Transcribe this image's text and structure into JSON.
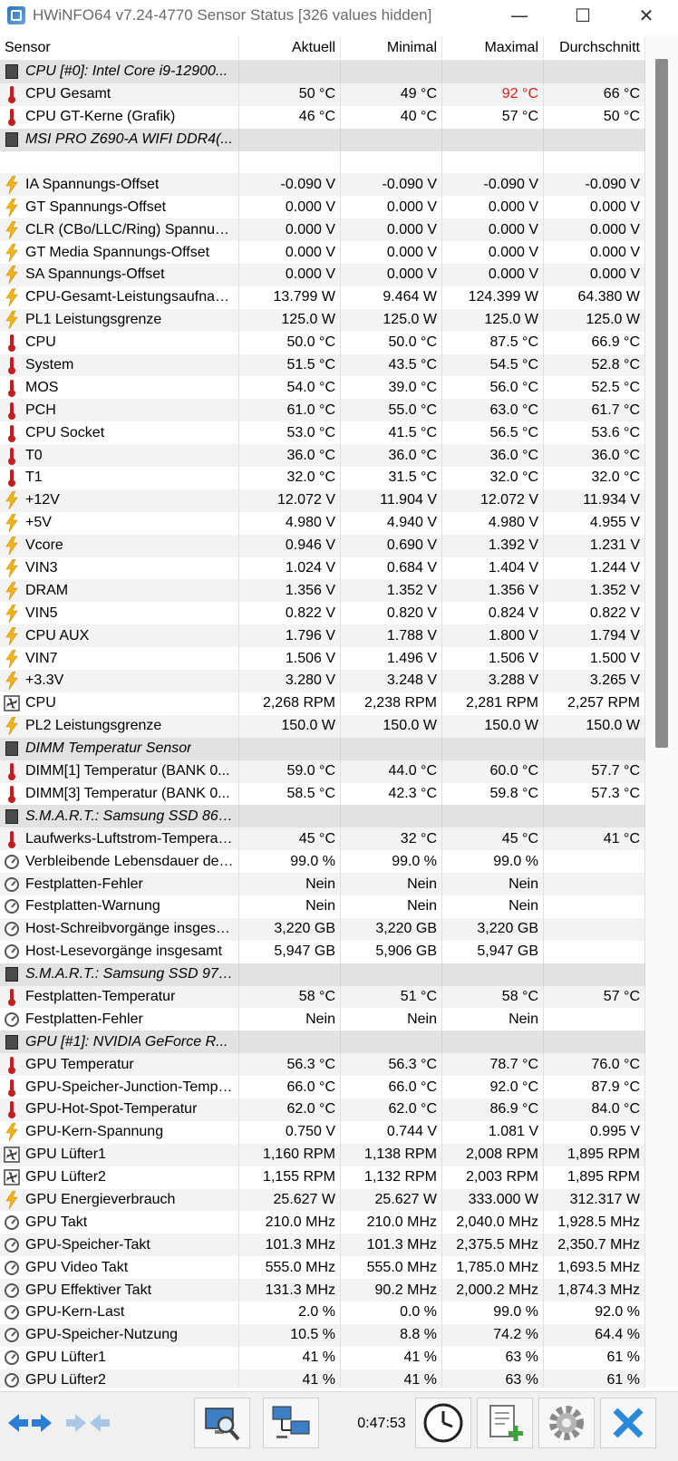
{
  "window": {
    "title": "HWiNFO64 v7.24-4770 Sensor Status [326 values hidden]",
    "minimize_glyph": "—",
    "maximize_glyph": "☐",
    "close_glyph": "✕"
  },
  "columns": [
    "Sensor",
    "Aktuell",
    "Minimal",
    "Maximal",
    "Durchschnitt"
  ],
  "rows": [
    {
      "type": "group",
      "icon": "chip-icon",
      "name": "CPU [#0]: Intel Core i9-12900...",
      "v": [
        "",
        "",
        "",
        ""
      ]
    },
    {
      "type": "data",
      "icon": "thermometer-icon",
      "name": "CPU Gesamt",
      "v": [
        "50 °C",
        "49 °C",
        "92 °C",
        "66 °C"
      ],
      "highlight_max": true
    },
    {
      "type": "data",
      "icon": "thermometer-icon",
      "name": "CPU GT-Kerne (Grafik)",
      "v": [
        "46 °C",
        "40 °C",
        "57 °C",
        "50 °C"
      ]
    },
    {
      "type": "group",
      "icon": "chip-icon",
      "name": "MSI PRO Z690-A WIFI DDR4(...",
      "v": [
        "",
        "",
        "",
        ""
      ]
    },
    {
      "type": "empty",
      "icon": "",
      "name": "",
      "v": [
        "",
        "",
        "",
        ""
      ]
    },
    {
      "type": "data",
      "icon": "lightning-icon",
      "name": "IA Spannungs-Offset",
      "v": [
        "-0.090 V",
        "-0.090 V",
        "-0.090 V",
        "-0.090 V"
      ]
    },
    {
      "type": "data",
      "icon": "lightning-icon",
      "name": "GT Spannungs-Offset",
      "v": [
        "0.000 V",
        "0.000 V",
        "0.000 V",
        "0.000 V"
      ]
    },
    {
      "type": "data",
      "icon": "lightning-icon",
      "name": "CLR (CBo/LLC/Ring) Spannung...",
      "v": [
        "0.000 V",
        "0.000 V",
        "0.000 V",
        "0.000 V"
      ]
    },
    {
      "type": "data",
      "icon": "lightning-icon",
      "name": "GT Media Spannungs-Offset",
      "v": [
        "0.000 V",
        "0.000 V",
        "0.000 V",
        "0.000 V"
      ]
    },
    {
      "type": "data",
      "icon": "lightning-icon",
      "name": "SA Spannungs-Offset",
      "v": [
        "0.000 V",
        "0.000 V",
        "0.000 V",
        "0.000 V"
      ]
    },
    {
      "type": "data",
      "icon": "lightning-icon",
      "name": "CPU-Gesamt-Leistungsaufnahme",
      "v": [
        "13.799 W",
        "9.464 W",
        "124.399 W",
        "64.380 W"
      ]
    },
    {
      "type": "data",
      "icon": "lightning-icon",
      "name": "PL1 Leistungsgrenze",
      "v": [
        "125.0 W",
        "125.0 W",
        "125.0 W",
        "125.0 W"
      ]
    },
    {
      "type": "data",
      "icon": "thermometer-icon",
      "name": "CPU",
      "v": [
        "50.0 °C",
        "50.0 °C",
        "87.5 °C",
        "66.9 °C"
      ]
    },
    {
      "type": "data",
      "icon": "thermometer-icon",
      "name": "System",
      "v": [
        "51.5 °C",
        "43.5 °C",
        "54.5 °C",
        "52.8 °C"
      ]
    },
    {
      "type": "data",
      "icon": "thermometer-icon",
      "name": "MOS",
      "v": [
        "54.0 °C",
        "39.0 °C",
        "56.0 °C",
        "52.5 °C"
      ]
    },
    {
      "type": "data",
      "icon": "thermometer-icon",
      "name": "PCH",
      "v": [
        "61.0 °C",
        "55.0 °C",
        "63.0 °C",
        "61.7 °C"
      ]
    },
    {
      "type": "data",
      "icon": "thermometer-icon",
      "name": "CPU Socket",
      "v": [
        "53.0 °C",
        "41.5 °C",
        "56.5 °C",
        "53.6 °C"
      ]
    },
    {
      "type": "data",
      "icon": "thermometer-icon",
      "name": "T0",
      "v": [
        "36.0 °C",
        "36.0 °C",
        "36.0 °C",
        "36.0 °C"
      ]
    },
    {
      "type": "data",
      "icon": "thermometer-icon",
      "name": "T1",
      "v": [
        "32.0 °C",
        "31.5 °C",
        "32.0 °C",
        "32.0 °C"
      ]
    },
    {
      "type": "data",
      "icon": "lightning-icon",
      "name": "+12V",
      "v": [
        "12.072 V",
        "11.904 V",
        "12.072 V",
        "11.934 V"
      ]
    },
    {
      "type": "data",
      "icon": "lightning-icon",
      "name": "+5V",
      "v": [
        "4.980 V",
        "4.940 V",
        "4.980 V",
        "4.955 V"
      ]
    },
    {
      "type": "data",
      "icon": "lightning-icon",
      "name": "Vcore",
      "v": [
        "0.946 V",
        "0.690 V",
        "1.392 V",
        "1.231 V"
      ]
    },
    {
      "type": "data",
      "icon": "lightning-icon",
      "name": "VIN3",
      "v": [
        "1.024 V",
        "0.684 V",
        "1.404 V",
        "1.244 V"
      ]
    },
    {
      "type": "data",
      "icon": "lightning-icon",
      "name": "DRAM",
      "v": [
        "1.356 V",
        "1.352 V",
        "1.356 V",
        "1.352 V"
      ]
    },
    {
      "type": "data",
      "icon": "lightning-icon",
      "name": "VIN5",
      "v": [
        "0.822 V",
        "0.820 V",
        "0.824 V",
        "0.822 V"
      ]
    },
    {
      "type": "data",
      "icon": "lightning-icon",
      "name": "CPU AUX",
      "v": [
        "1.796 V",
        "1.788 V",
        "1.800 V",
        "1.794 V"
      ]
    },
    {
      "type": "data",
      "icon": "lightning-icon",
      "name": "VIN7",
      "v": [
        "1.506 V",
        "1.496 V",
        "1.506 V",
        "1.500 V"
      ]
    },
    {
      "type": "data",
      "icon": "lightning-icon",
      "name": "+3.3V",
      "v": [
        "3.280 V",
        "3.248 V",
        "3.288 V",
        "3.265 V"
      ]
    },
    {
      "type": "data",
      "icon": "fan-icon",
      "name": "CPU",
      "v": [
        "2,268 RPM",
        "2,238 RPM",
        "2,281 RPM",
        "2,257 RPM"
      ]
    },
    {
      "type": "data",
      "icon": "lightning-icon",
      "name": "PL2 Leistungsgrenze",
      "v": [
        "150.0 W",
        "150.0 W",
        "150.0 W",
        "150.0 W"
      ]
    },
    {
      "type": "group",
      "icon": "chip-icon",
      "name": "DIMM Temperatur Sensor",
      "v": [
        "",
        "",
        "",
        ""
      ]
    },
    {
      "type": "data",
      "icon": "thermometer-icon",
      "name": "DIMM[1] Temperatur (BANK 0...",
      "v": [
        "59.0 °C",
        "44.0 °C",
        "60.0 °C",
        "57.7 °C"
      ]
    },
    {
      "type": "data",
      "icon": "thermometer-icon",
      "name": "DIMM[3] Temperatur (BANK 0...",
      "v": [
        "58.5 °C",
        "42.3 °C",
        "59.8 °C",
        "57.3 °C"
      ]
    },
    {
      "type": "group",
      "icon": "chip-icon",
      "name": "S.M.A.R.T.: Samsung SSD 860...",
      "v": [
        "",
        "",
        "",
        ""
      ]
    },
    {
      "type": "data",
      "icon": "thermometer-icon",
      "name": "Laufwerks-Luftstrom-Temperatur",
      "v": [
        "45 °C",
        "32 °C",
        "45 °C",
        "41 °C"
      ]
    },
    {
      "type": "data",
      "icon": "gauge-icon",
      "name": "Verbleibende Lebensdauer der ...",
      "v": [
        "99.0 %",
        "99.0 %",
        "99.0 %",
        ""
      ]
    },
    {
      "type": "data",
      "icon": "gauge-icon",
      "name": "Festplatten-Fehler",
      "v": [
        "Nein",
        "Nein",
        "Nein",
        ""
      ]
    },
    {
      "type": "data",
      "icon": "gauge-icon",
      "name": "Festplatten-Warnung",
      "v": [
        "Nein",
        "Nein",
        "Nein",
        ""
      ]
    },
    {
      "type": "data",
      "icon": "gauge-icon",
      "name": "Host-Schreibvorgänge insgesamt",
      "v": [
        "3,220 GB",
        "3,220 GB",
        "3,220 GB",
        ""
      ]
    },
    {
      "type": "data",
      "icon": "gauge-icon",
      "name": "Host-Lesevorgänge insgesamt",
      "v": [
        "5,947 GB",
        "5,906 GB",
        "5,947 GB",
        ""
      ]
    },
    {
      "type": "group",
      "icon": "chip-icon",
      "name": "S.M.A.R.T.: Samsung SSD 970...",
      "v": [
        "",
        "",
        "",
        ""
      ]
    },
    {
      "type": "data",
      "icon": "thermometer-icon",
      "name": "Festplatten-Temperatur",
      "v": [
        "58 °C",
        "51 °C",
        "58 °C",
        "57 °C"
      ]
    },
    {
      "type": "data",
      "icon": "gauge-icon",
      "name": "Festplatten-Fehler",
      "v": [
        "Nein",
        "Nein",
        "Nein",
        ""
      ]
    },
    {
      "type": "group",
      "icon": "chip-icon",
      "name": "GPU [#1]: NVIDIA GeForce R...",
      "v": [
        "",
        "",
        "",
        ""
      ]
    },
    {
      "type": "data",
      "icon": "thermometer-icon",
      "name": "GPU Temperatur",
      "v": [
        "56.3 °C",
        "56.3 °C",
        "78.7 °C",
        "76.0 °C"
      ]
    },
    {
      "type": "data",
      "icon": "thermometer-icon",
      "name": "GPU-Speicher-Junction-Tempe...",
      "v": [
        "66.0 °C",
        "66.0 °C",
        "92.0 °C",
        "87.9 °C"
      ]
    },
    {
      "type": "data",
      "icon": "thermometer-icon",
      "name": "GPU-Hot-Spot-Temperatur",
      "v": [
        "62.0 °C",
        "62.0 °C",
        "86.9 °C",
        "84.0 °C"
      ]
    },
    {
      "type": "data",
      "icon": "lightning-icon",
      "name": "GPU-Kern-Spannung",
      "v": [
        "0.750 V",
        "0.744 V",
        "1.081 V",
        "0.995 V"
      ]
    },
    {
      "type": "data",
      "icon": "fan-icon",
      "name": "GPU Lüfter1",
      "v": [
        "1,160 RPM",
        "1,138 RPM",
        "2,008 RPM",
        "1,895 RPM"
      ]
    },
    {
      "type": "data",
      "icon": "fan-icon",
      "name": "GPU Lüfter2",
      "v": [
        "1,155 RPM",
        "1,132 RPM",
        "2,003 RPM",
        "1,895 RPM"
      ]
    },
    {
      "type": "data",
      "icon": "lightning-icon",
      "name": "GPU Energieverbrauch",
      "v": [
        "25.627 W",
        "25.627 W",
        "333.000 W",
        "312.317 W"
      ]
    },
    {
      "type": "data",
      "icon": "gauge-icon",
      "name": "GPU Takt",
      "v": [
        "210.0 MHz",
        "210.0 MHz",
        "2,040.0 MHz",
        "1,928.5 MHz"
      ]
    },
    {
      "type": "data",
      "icon": "gauge-icon",
      "name": "GPU-Speicher-Takt",
      "v": [
        "101.3 MHz",
        "101.3 MHz",
        "2,375.5 MHz",
        "2,350.7 MHz"
      ]
    },
    {
      "type": "data",
      "icon": "gauge-icon",
      "name": "GPU Video Takt",
      "v": [
        "555.0 MHz",
        "555.0 MHz",
        "1,785.0 MHz",
        "1,693.5 MHz"
      ]
    },
    {
      "type": "data",
      "icon": "gauge-icon",
      "name": "GPU Effektiver Takt",
      "v": [
        "131.3 MHz",
        "90.2 MHz",
        "2,000.2 MHz",
        "1,874.3 MHz"
      ]
    },
    {
      "type": "data",
      "icon": "gauge-icon",
      "name": "GPU-Kern-Last",
      "v": [
        "2.0 %",
        "0.0 %",
        "99.0 %",
        "92.0 %"
      ]
    },
    {
      "type": "data",
      "icon": "gauge-icon",
      "name": "GPU-Speicher-Nutzung",
      "v": [
        "10.5 %",
        "8.8 %",
        "74.2 %",
        "64.4 %"
      ]
    },
    {
      "type": "data",
      "icon": "gauge-icon",
      "name": "GPU Lüfter1",
      "v": [
        "41 %",
        "41 %",
        "63 %",
        "61 %"
      ]
    },
    {
      "type": "data",
      "icon": "gauge-icon",
      "name": "GPU Lüfter2",
      "v": [
        "41 %",
        "41 %",
        "63 %",
        "61 %"
      ]
    }
  ],
  "toolbar": {
    "timer": "0:47:53",
    "buttons": [
      "expand-arrows-icon",
      "collapse-arrows-icon",
      "search-monitor-icon",
      "network-icon",
      "clock-icon",
      "add-report-icon",
      "settings-gear-icon",
      "close-x-icon"
    ]
  },
  "colors": {
    "highlight_red": "#d81e1e",
    "group_bg": "#e2e2e2",
    "alt_row_bg": "#f3f3f3"
  }
}
